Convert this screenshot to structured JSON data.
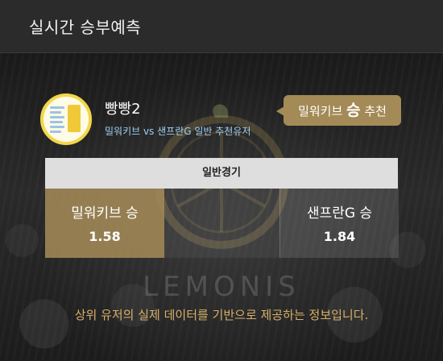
{
  "header": {
    "title": "실시간 승부예측"
  },
  "user": {
    "name": "빵빵2",
    "subtitle": "밀워키브 vs 샌프란G 일반 추천유저"
  },
  "recommendation": {
    "team": "밀워키브",
    "result": "승",
    "suffix": "추천"
  },
  "game": {
    "type": "일반경기",
    "home": {
      "label": "밀워키브 승",
      "odds": "1.58"
    },
    "away": {
      "label": "샌프란G 승",
      "odds": "1.84"
    }
  },
  "watermark": "LEMONIS",
  "footer": {
    "note": "상위 유저의 실제 데이터를 기반으로 제공하는 정보입니다."
  },
  "colors": {
    "accent": "#a38a56",
    "footer_text": "#d8b06a",
    "subtitle": "#9fd0f2",
    "avatar_ring": "#f3d64a"
  }
}
